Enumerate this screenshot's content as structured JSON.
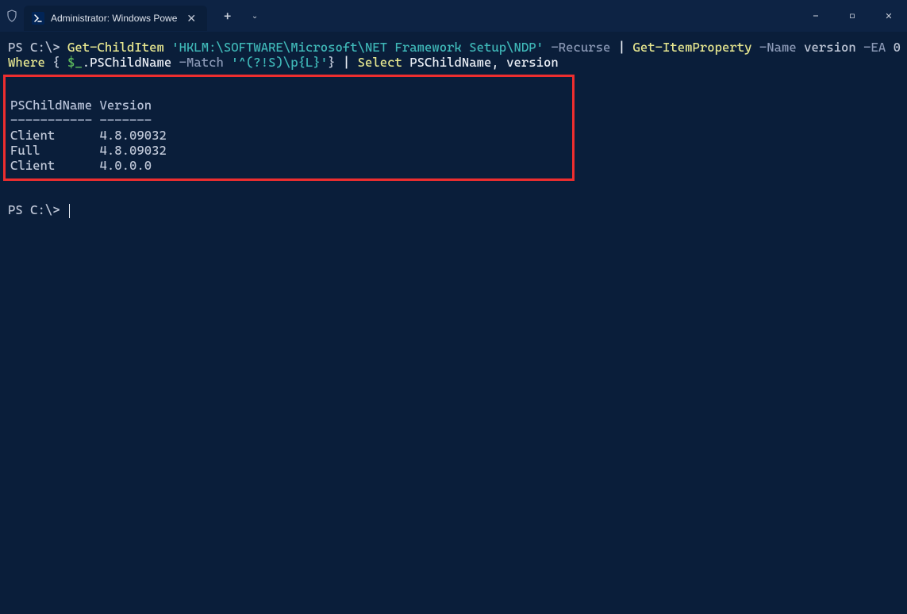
{
  "title_bar": {
    "tab_title": "Administrator: Windows Powe",
    "new_tab_glyph": "+",
    "dropdown_glyph": "⌄",
    "minimize": "—",
    "maximize": "□",
    "close": "✕"
  },
  "terminal": {
    "prompt": "PS C:\\> ",
    "command": {
      "cmdlet1": "Get-ChildItem ",
      "path": "'HKLM:\\SOFTWARE\\Microsoft\\NET Framework Setup\\NDP' ",
      "arg_recurse": "-Recurse ",
      "pipe1": "| ",
      "cmdlet2": "Get-ItemProperty ",
      "arg_name": "-Name ",
      "val_name": "version ",
      "arg_ea": "-EA ",
      "val_ea": "0 ",
      "pipe2": "|",
      "cmdlet3": "Where ",
      "brace_open": "{ ",
      "dollar_und": "$_",
      "dot_pschild": ".PSChildName ",
      "match": "-Match ",
      "regex": "'^(?!S)\\p{L}'",
      "brace_close": "} ",
      "pipe3": "| ",
      "cmdlet4": "Select ",
      "select_args": "PSChildName, version"
    },
    "output": {
      "header_col1": "PSChildName",
      "header_col2": "Version",
      "underline_col1": "-----------",
      "underline_col2": "-------",
      "rows": [
        {
          "name": "Client",
          "ver": "4.8.09032"
        },
        {
          "name": "Full",
          "ver": "4.8.09032"
        },
        {
          "name": "Client",
          "ver": "4.0.0.0"
        }
      ]
    },
    "prompt2": "PS C:\\> "
  }
}
